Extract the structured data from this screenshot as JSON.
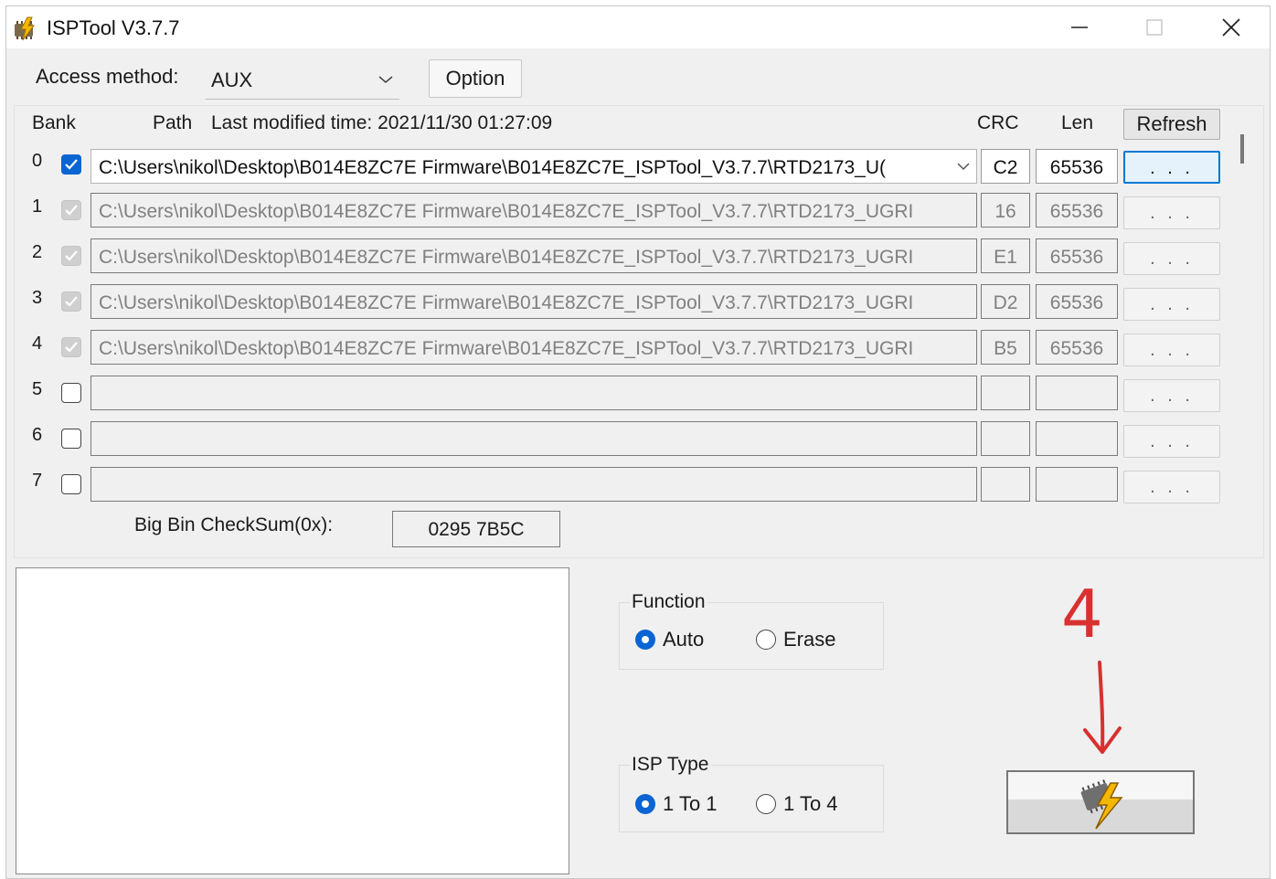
{
  "window": {
    "title": "ISPTool V3.7.7",
    "controls": [
      "minimize",
      "maximize",
      "close"
    ]
  },
  "access": {
    "label": "Access method:",
    "value": "AUX",
    "option_button": "Option"
  },
  "bank_table": {
    "headers": {
      "bank": "Bank",
      "path": "Path",
      "last_modified": "Last modified time: 2021/11/30 01:27:09",
      "crc": "CRC",
      "len": "Len"
    },
    "refresh_button": "Refresh",
    "browse_label": ". . .",
    "rows": [
      {
        "index": "0",
        "checked": true,
        "enabled": true,
        "path": "C:\\Users\\nikol\\Desktop\\B014E8ZC7E Firmware\\B014E8ZC7E_ISPTool_V3.7.7\\RTD2173_U(",
        "crc": "C2",
        "len": "65536"
      },
      {
        "index": "1",
        "checked": true,
        "enabled": false,
        "path": "C:\\Users\\nikol\\Desktop\\B014E8ZC7E Firmware\\B014E8ZC7E_ISPTool_V3.7.7\\RTD2173_UGRI",
        "crc": "16",
        "len": "65536"
      },
      {
        "index": "2",
        "checked": true,
        "enabled": false,
        "path": "C:\\Users\\nikol\\Desktop\\B014E8ZC7E Firmware\\B014E8ZC7E_ISPTool_V3.7.7\\RTD2173_UGRI",
        "crc": "E1",
        "len": "65536"
      },
      {
        "index": "3",
        "checked": true,
        "enabled": false,
        "path": "C:\\Users\\nikol\\Desktop\\B014E8ZC7E Firmware\\B014E8ZC7E_ISPTool_V3.7.7\\RTD2173_UGRI",
        "crc": "D2",
        "len": "65536"
      },
      {
        "index": "4",
        "checked": true,
        "enabled": false,
        "path": "C:\\Users\\nikol\\Desktop\\B014E8ZC7E Firmware\\B014E8ZC7E_ISPTool_V3.7.7\\RTD2173_UGRI",
        "crc": "B5",
        "len": "65536"
      },
      {
        "index": "5",
        "checked": false,
        "enabled": true,
        "path": "",
        "crc": "",
        "len": ""
      },
      {
        "index": "6",
        "checked": false,
        "enabled": true,
        "path": "",
        "crc": "",
        "len": ""
      },
      {
        "index": "7",
        "checked": false,
        "enabled": true,
        "path": "",
        "crc": "",
        "len": ""
      }
    ],
    "checksum_label": "Big Bin CheckSum(0x):",
    "checksum_value": "0295 7B5C"
  },
  "function_group": {
    "title": "Function",
    "options": [
      "Auto",
      "Erase"
    ],
    "selected": "Auto"
  },
  "isp_type_group": {
    "title": "ISP Type",
    "options": [
      "1 To 1",
      "1 To 4"
    ],
    "selected": "1 To 1"
  },
  "annotation": {
    "text": "4",
    "color": "#d93030"
  },
  "icons": {
    "app": "chip-lightning-icon",
    "flash": "chip-lightning-icon"
  },
  "colors": {
    "accent": "#0a64d2",
    "focus_border": "#0078d7"
  }
}
